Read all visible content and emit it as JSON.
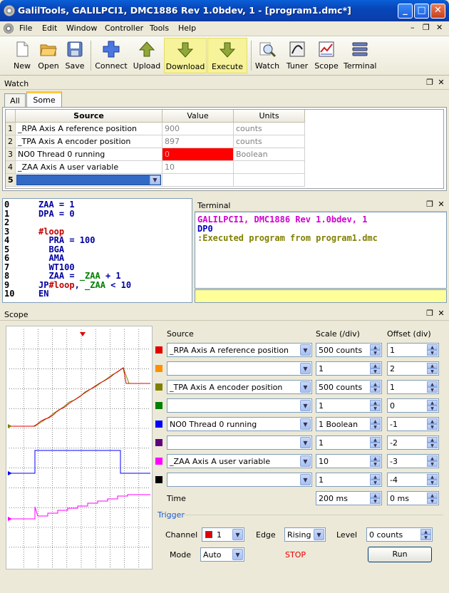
{
  "window": {
    "title": "GalilTools, GALILPCI1, DMC1886 Rev 1.0bdev, 1 - [program1.dmc*]"
  },
  "menu": [
    "File",
    "Edit",
    "Window",
    "Controller",
    "Tools",
    "Help"
  ],
  "toolbar": {
    "new": "New",
    "open": "Open",
    "save": "Save",
    "connect": "Connect",
    "upload": "Upload",
    "download": "Download",
    "execute": "Execute",
    "watch": "Watch",
    "tuner": "Tuner",
    "scope": "Scope",
    "terminal": "Terminal"
  },
  "watch": {
    "title": "Watch",
    "tabs": [
      "All",
      "Some"
    ],
    "columns": [
      "Source",
      "Value",
      "Units"
    ],
    "rows": [
      {
        "n": "1",
        "source": "_RPA Axis A reference position",
        "value": "900",
        "units": "counts"
      },
      {
        "n": "2",
        "source": "_TPA Axis A encoder position",
        "value": "897",
        "units": "counts"
      },
      {
        "n": "3",
        "source": "NO0 Thread 0 running",
        "value": "0",
        "units": "Boolean"
      },
      {
        "n": "4",
        "source": "_ZAA Axis A user variable",
        "value": "10",
        "units": ""
      },
      {
        "n": "5",
        "source": "",
        "value": "",
        "units": ""
      }
    ]
  },
  "editor": {
    "line_numbers": [
      "0",
      "1",
      "2",
      "3",
      "4",
      "5",
      "6",
      "7",
      "8",
      "9",
      "10"
    ]
  },
  "terminal": {
    "title": "Terminal",
    "line1": "GALILPCI1, DMC1886 Rev 1.0bdev, 1",
    "line2": "DP0",
    "line3": ":Executed program from program1.dmc",
    "input": ""
  },
  "scope": {
    "title": "Scope",
    "headers": {
      "source": "Source",
      "scale": "Scale (/div)",
      "offset": "Offset (div)"
    },
    "channels": [
      {
        "color": "#e00000",
        "source": "_RPA Axis A reference position",
        "scale": "500 counts",
        "offset": "1"
      },
      {
        "color": "#ff9000",
        "source": "",
        "scale": "1",
        "offset": "2"
      },
      {
        "color": "#808000",
        "source": "_TPA Axis A encoder position",
        "scale": "500 counts",
        "offset": "1"
      },
      {
        "color": "#008000",
        "source": "",
        "scale": "1",
        "offset": "0"
      },
      {
        "color": "#0000ff",
        "source": "NO0 Thread 0 running",
        "scale": "1 Boolean",
        "offset": "-1"
      },
      {
        "color": "#600080",
        "source": "",
        "scale": "1",
        "offset": "-2"
      },
      {
        "color": "#ff00ff",
        "source": "_ZAA Axis A user variable",
        "scale": "10",
        "offset": "-3"
      },
      {
        "color": "#000000",
        "source": "",
        "scale": "1",
        "offset": "-4"
      }
    ],
    "time_label": "Time",
    "time_scale": "200 ms",
    "time_offset": "0 ms",
    "trigger": {
      "label": "Trigger",
      "channel_label": "Channel",
      "channel": "1",
      "channel_color": "#e00000",
      "edge_label": "Edge",
      "edge": "Rising",
      "level_label": "Level",
      "level": "0 counts",
      "mode_label": "Mode",
      "mode": "Auto",
      "status": "STOP",
      "run": "Run"
    }
  }
}
